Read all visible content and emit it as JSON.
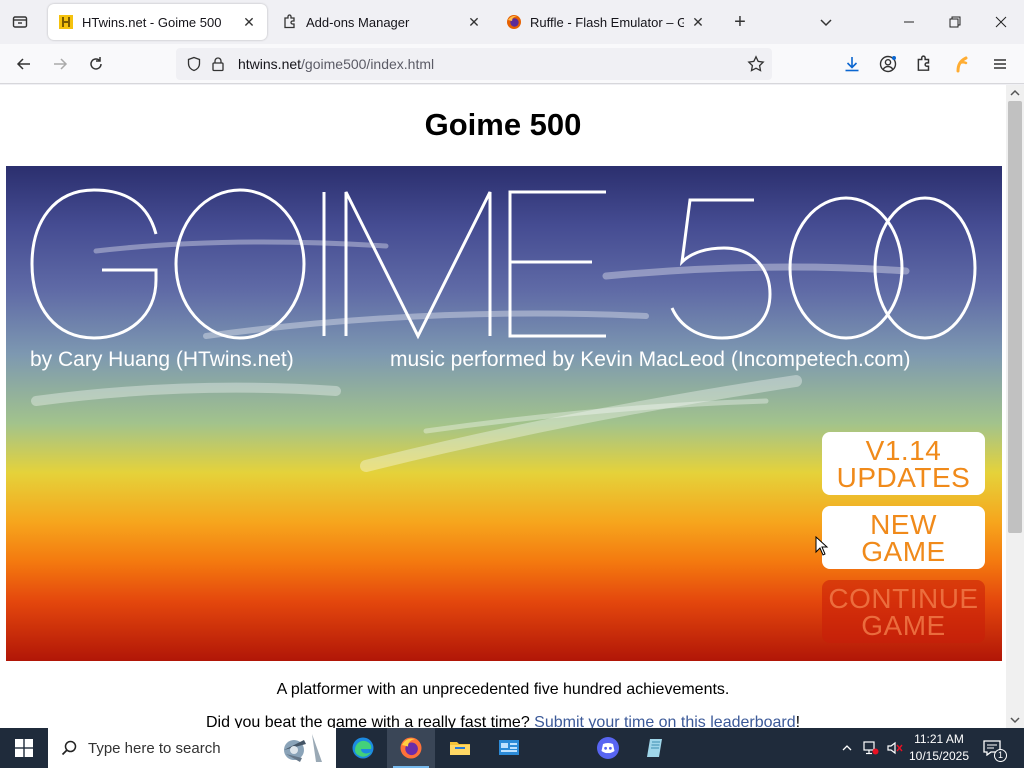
{
  "browser": {
    "tabs": [
      {
        "title": "HTwins.net - Goime 500",
        "active": true
      },
      {
        "title": "Add-ons Manager",
        "active": false
      },
      {
        "title": "Ruffle - Flash Emulator – Get this Extension for Firefox",
        "active": false
      }
    ],
    "url_host": "htwins.net",
    "url_path": "/goime500/index.html"
  },
  "page": {
    "title": "Goime 500",
    "game": {
      "logo_text": "GOIME 500",
      "credit_author": "by Cary Huang (HTwins.net)",
      "credit_music": "music performed by Kevin MacLeod (Incompetech.com)",
      "buttons": [
        {
          "line1": "V1.14",
          "line2": "UPDATES",
          "enabled": true
        },
        {
          "line1": "NEW",
          "line2": "GAME",
          "enabled": true
        },
        {
          "line1": "CONTINUE",
          "line2": "GAME",
          "enabled": false
        }
      ]
    },
    "description": "A platformer with an unprecedented five hundred achievements.",
    "leaderboard_prefix": "Did you beat the game with a really fast time? ",
    "leaderboard_link": "Submit your time on this leaderboard",
    "leaderboard_suffix": "!"
  },
  "taskbar": {
    "search_placeholder": "Type here to search",
    "time": "11:21 AM",
    "date": "10/15/2025",
    "notification_count": "1"
  },
  "colors": {
    "button_text": "#f08a1a",
    "link": "#3b5998",
    "taskbar": "#1f2b3b"
  }
}
